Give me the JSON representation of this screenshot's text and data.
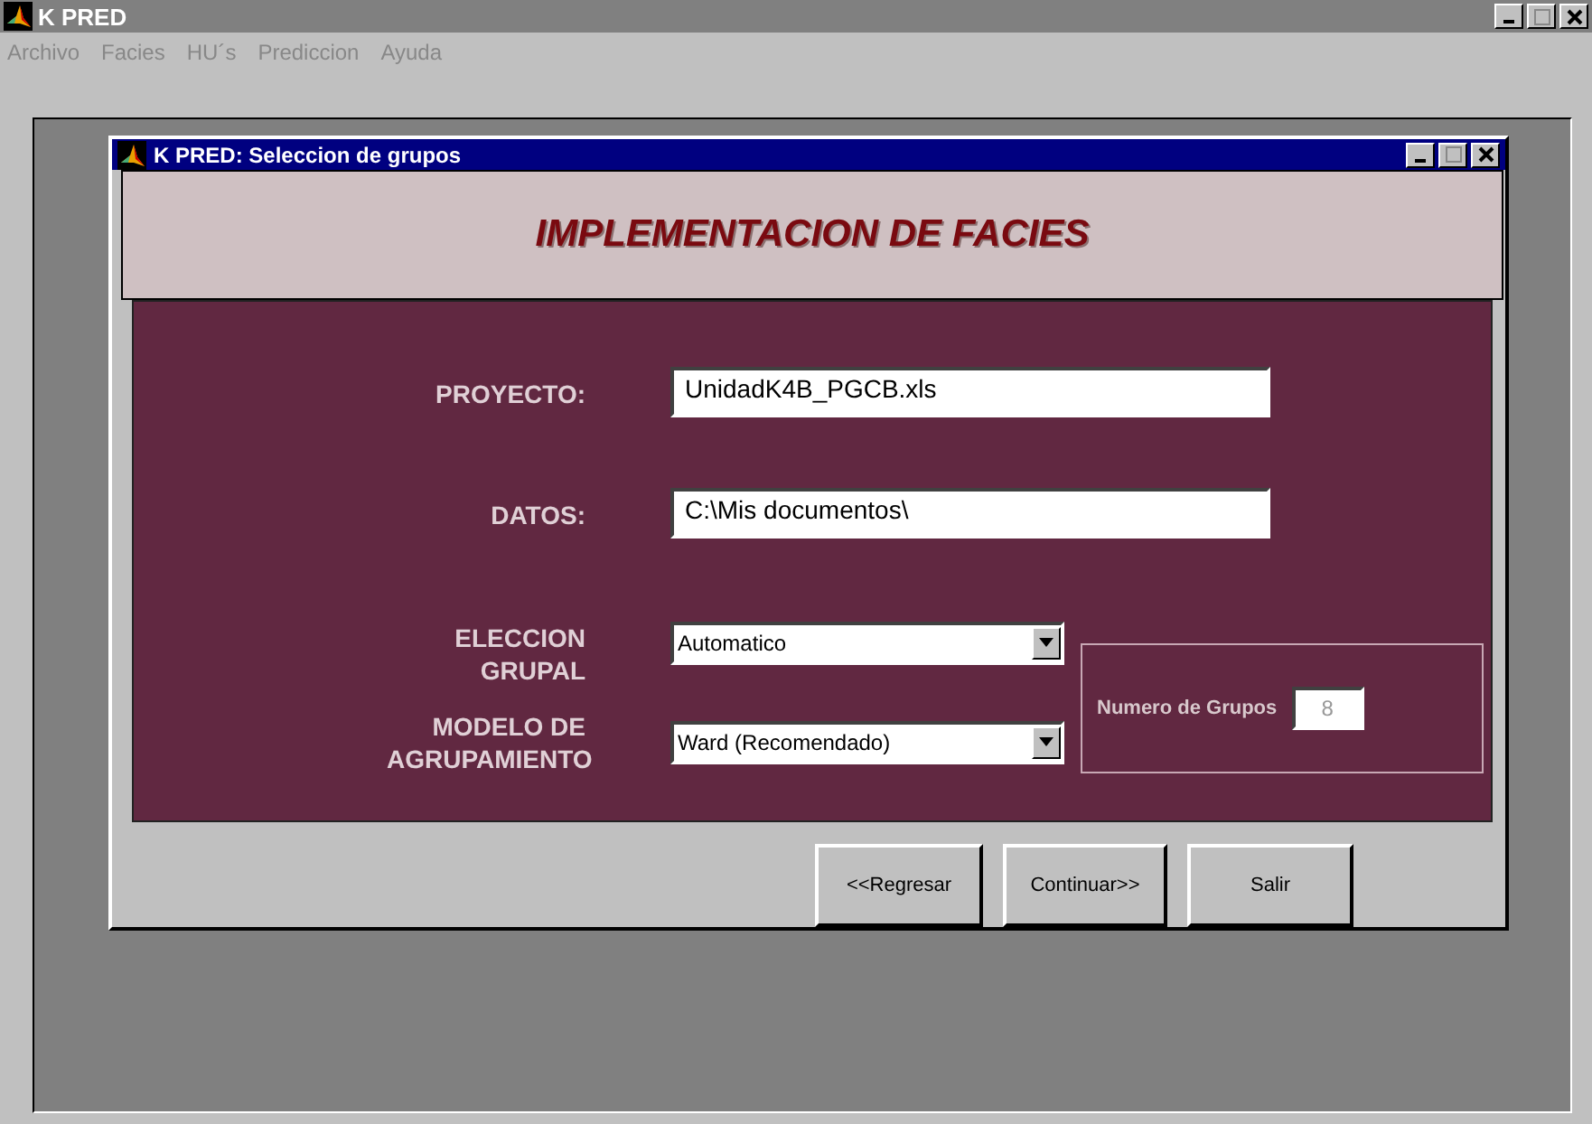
{
  "window": {
    "title": "K PRED"
  },
  "menu": [
    "Archivo",
    "Facies",
    "HU´s",
    "Prediccion",
    "Ayuda"
  ],
  "dialog": {
    "title": "K PRED: Seleccion de grupos",
    "header": "IMPLEMENTACION DE FACIES",
    "fields": [
      {
        "label": "PROYECTO:",
        "value": "UnidadK4B_PGCB.xls"
      },
      {
        "label": "DATOS:",
        "value": "C:\\Mis documentos\\"
      }
    ],
    "selects": [
      {
        "label": "ELECCION GRUPAL",
        "value": "Automatico"
      },
      {
        "label": "MODELO DE AGRUPAMIENTO",
        "value": "Ward (Recomendado)"
      }
    ],
    "group_count": {
      "label": "Numero de Grupos",
      "value": "8",
      "disabled": true
    },
    "buttons": [
      "<<Regresar",
      "Continuar>>",
      "Salir"
    ]
  }
}
